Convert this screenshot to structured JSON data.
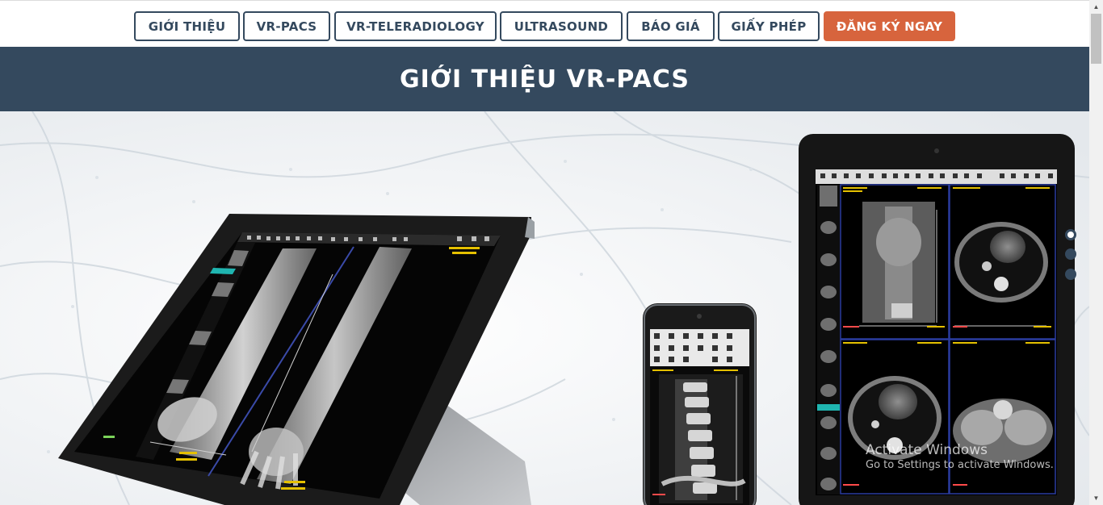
{
  "nav": {
    "items": [
      {
        "label": "GIỚI THIỆU"
      },
      {
        "label": "VR-PACS"
      },
      {
        "label": "VR-TELERADIOLOGY"
      },
      {
        "label": "ULTRASOUND"
      },
      {
        "label": "BÁO GIÁ"
      },
      {
        "label": "GIẤY PHÉP"
      }
    ],
    "cta_label": "ĐĂNG KÝ NGAY"
  },
  "header": {
    "title": "GIỚI THIỆU VR-PACS"
  },
  "hero": {
    "devices": [
      "laptop-2in1",
      "smartphone",
      "tablet"
    ],
    "slider_count": 3,
    "slider_active": 1
  },
  "watermark": {
    "line1": "Activate Windows",
    "line2": "Go to Settings to activate Windows."
  },
  "colors": {
    "brand": "#34495e",
    "accent": "#d7643d",
    "ct_label": "#e5c000"
  },
  "icons": {
    "scroll_up": "chevron-up-icon",
    "scroll_down": "chevron-down-icon"
  }
}
